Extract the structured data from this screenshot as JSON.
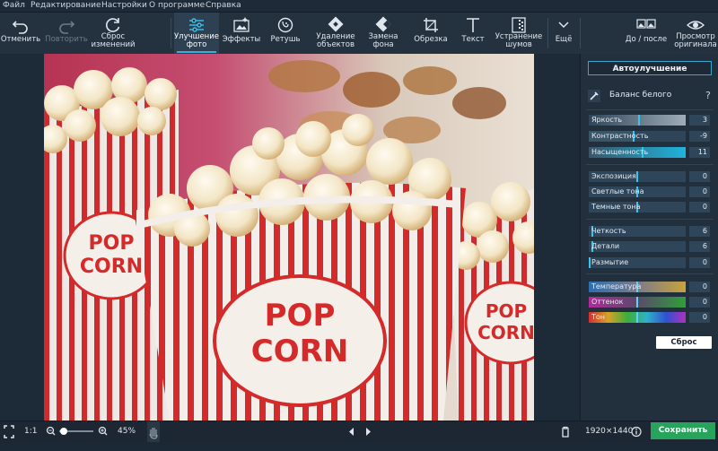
{
  "menu": [
    "Файл",
    "Редактирование",
    "Настройки",
    "О программе",
    "Справка"
  ],
  "toolbar": {
    "undo": "Отменить",
    "redo": "Повторить",
    "reset_changes": [
      "Сброс",
      "изменений"
    ],
    "tools": [
      [
        "Улучшение",
        "фото"
      ],
      [
        "Эффекты"
      ],
      [
        "Ретушь"
      ],
      [
        "Удаление",
        "объектов"
      ],
      [
        "Замена",
        "фона"
      ],
      [
        "Обрезка"
      ],
      [
        "Текст"
      ],
      [
        "Устранение",
        "шумов"
      ],
      [
        "Ещё"
      ]
    ],
    "before_after": "До / после",
    "view_original": [
      "Просмотр",
      "оригинала"
    ]
  },
  "panel": {
    "auto_enhance": "Автоулучшение",
    "white_balance": "Баланс белого",
    "help": "?",
    "groups": [
      [
        {
          "label": "Яркость",
          "value": 3
        },
        {
          "label": "Контрастность",
          "value": -9
        },
        {
          "label": "Насыщенность",
          "value": 11
        }
      ],
      [
        {
          "label": "Экспозиция",
          "value": 0
        },
        {
          "label": "Светлые тона",
          "value": 0
        },
        {
          "label": "Темные тона",
          "value": 0
        }
      ],
      [
        {
          "label": "Четкость",
          "value": 6
        },
        {
          "label": "Детали",
          "value": 6
        },
        {
          "label": "Размытие",
          "value": 0
        }
      ],
      [
        {
          "label": "Температура",
          "value": 0
        },
        {
          "label": "Оттенок",
          "value": 0
        },
        {
          "label": "Тон",
          "value": 0
        }
      ]
    ],
    "reset": "Сброс"
  },
  "photo": {
    "box_lettering": [
      "POP",
      "CORN"
    ]
  },
  "statusbar": {
    "one_to_one": "1:1",
    "zoom": "45%",
    "dimensions": "1920×1440",
    "save": "Сохранить"
  },
  "colors": {
    "accent": "#2fb2dd",
    "save_green": "#27a35b",
    "popcorn_red": "#d42a2a"
  }
}
